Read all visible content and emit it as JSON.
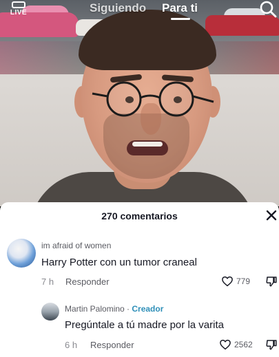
{
  "topnav": {
    "live_label": "LIVE",
    "tab_following": "Siguiendo",
    "tab_for_you": "Para ti",
    "active_tab": "Para ti"
  },
  "comments_sheet": {
    "title": "270 comentarios",
    "comments": [
      {
        "username": "im afraid of women",
        "text": "Harry Potter con un tumor craneal",
        "time": "7 h",
        "reply_label": "Responder",
        "likes": "779"
      },
      {
        "username": "Martin Palomino",
        "separator": " · ",
        "badge": "Creador",
        "text": "Pregúntale a tú madre por la varita",
        "time": "6 h",
        "reply_label": "Responder",
        "likes": "2562"
      }
    ]
  },
  "colors": {
    "creator_badge": "#2e8fb8",
    "sheet_bg": "#ffffff",
    "text_primary": "#161823",
    "text_secondary": "#8a8b91"
  },
  "icons": [
    "live-icon",
    "search-icon",
    "close-icon",
    "heart-icon",
    "dislike-icon"
  ]
}
